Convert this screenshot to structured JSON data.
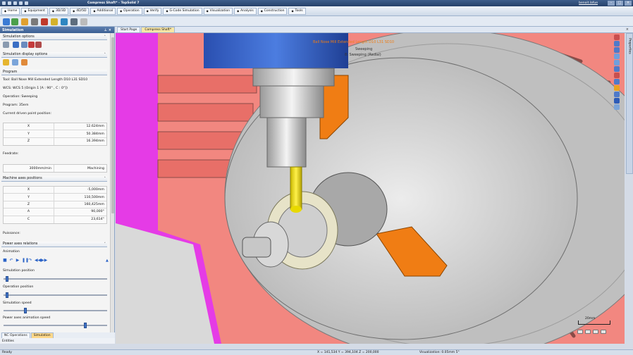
{
  "window": {
    "title": "Compress Shaft* - TopSolid 7",
    "user": "benoit.lafue"
  },
  "ribbon": {
    "tabs": [
      {
        "label": "Home",
        "icon": "home-icon"
      },
      {
        "label": "Equipment",
        "icon": "equipment-icon"
      },
      {
        "label": "3D/3D",
        "icon": "3d-icon"
      },
      {
        "label": "4D/5D",
        "icon": "5d-icon"
      },
      {
        "label": "Additional",
        "icon": "additional-icon"
      },
      {
        "label": "Operation",
        "icon": "operation-icon"
      },
      {
        "label": "Verify",
        "icon": "verify-icon"
      },
      {
        "label": "G-Code Simulation",
        "icon": "gcode-icon"
      },
      {
        "label": "Visualization",
        "icon": "visualization-icon"
      },
      {
        "label": "Analysis",
        "icon": "analysis-icon"
      },
      {
        "label": "Construction",
        "icon": "construction-icon"
      },
      {
        "label": "Tools",
        "icon": "tools-icon"
      }
    ]
  },
  "panel": {
    "title": "Simulation",
    "sim_options": "Simulation options",
    "display_options": "Simulation display options",
    "program_header": "Program",
    "tool": "Tool: Ball Nose Mill Extended Length D10 L31 SD10",
    "wcs": "WCS: WCS 5 (Origin 1 [A : 90° , C : 0°])",
    "operation": "Operation: Sweeping",
    "program": "Program: 35ern",
    "driven_point": "Current driven point position:",
    "driven": [
      {
        "axis": "X",
        "value": "12.624mm"
      },
      {
        "axis": "Y",
        "value": "50.384mm"
      },
      {
        "axis": "Z",
        "value": "16.394mm"
      }
    ],
    "feedrate_label": "Feedrate:",
    "feedrate_value": "3000mm/min",
    "feedrate_mode": "Machining",
    "machine_axes": "Machine axes positions",
    "axes": [
      {
        "axis": "X",
        "value": "-5,000mm"
      },
      {
        "axis": "Y",
        "value": "110,500mm"
      },
      {
        "axis": "Z",
        "value": "160,425mm"
      },
      {
        "axis": "A",
        "value": "90,000°"
      },
      {
        "axis": "C",
        "value": "23,614°"
      }
    ],
    "power_label": "Puissance:",
    "power_axes": "Power axes relations",
    "animation": "Animation",
    "sim_position": "Simulation position",
    "op_position": "Operation position",
    "sim_speed": "Simulation speed",
    "power_speed": "Power axes animation speed",
    "sim_position_value": 0.02,
    "op_position_value": 0.02,
    "sim_speed_value": 0.2,
    "power_speed_value": 0.8,
    "bottom_tabs": [
      "NC Operations",
      "Simulation"
    ],
    "bottom_row": "Entities"
  },
  "doc_tabs": [
    "Start Page",
    "Compress Shaft*"
  ],
  "viewport": {
    "tool_label": "Ball Nose Mill Extended Length D10 L31 SD10",
    "op_label": "Sweeping",
    "sub_label": "8: Sweeping (Radial)",
    "scale": "20mm"
  },
  "right_side_tab": "Properties",
  "status": {
    "ready": "Ready",
    "coords": "X = 141,534   Y = 394,104   Z = 200,000",
    "visualization": "Visualization: 0.05mm 5°"
  }
}
